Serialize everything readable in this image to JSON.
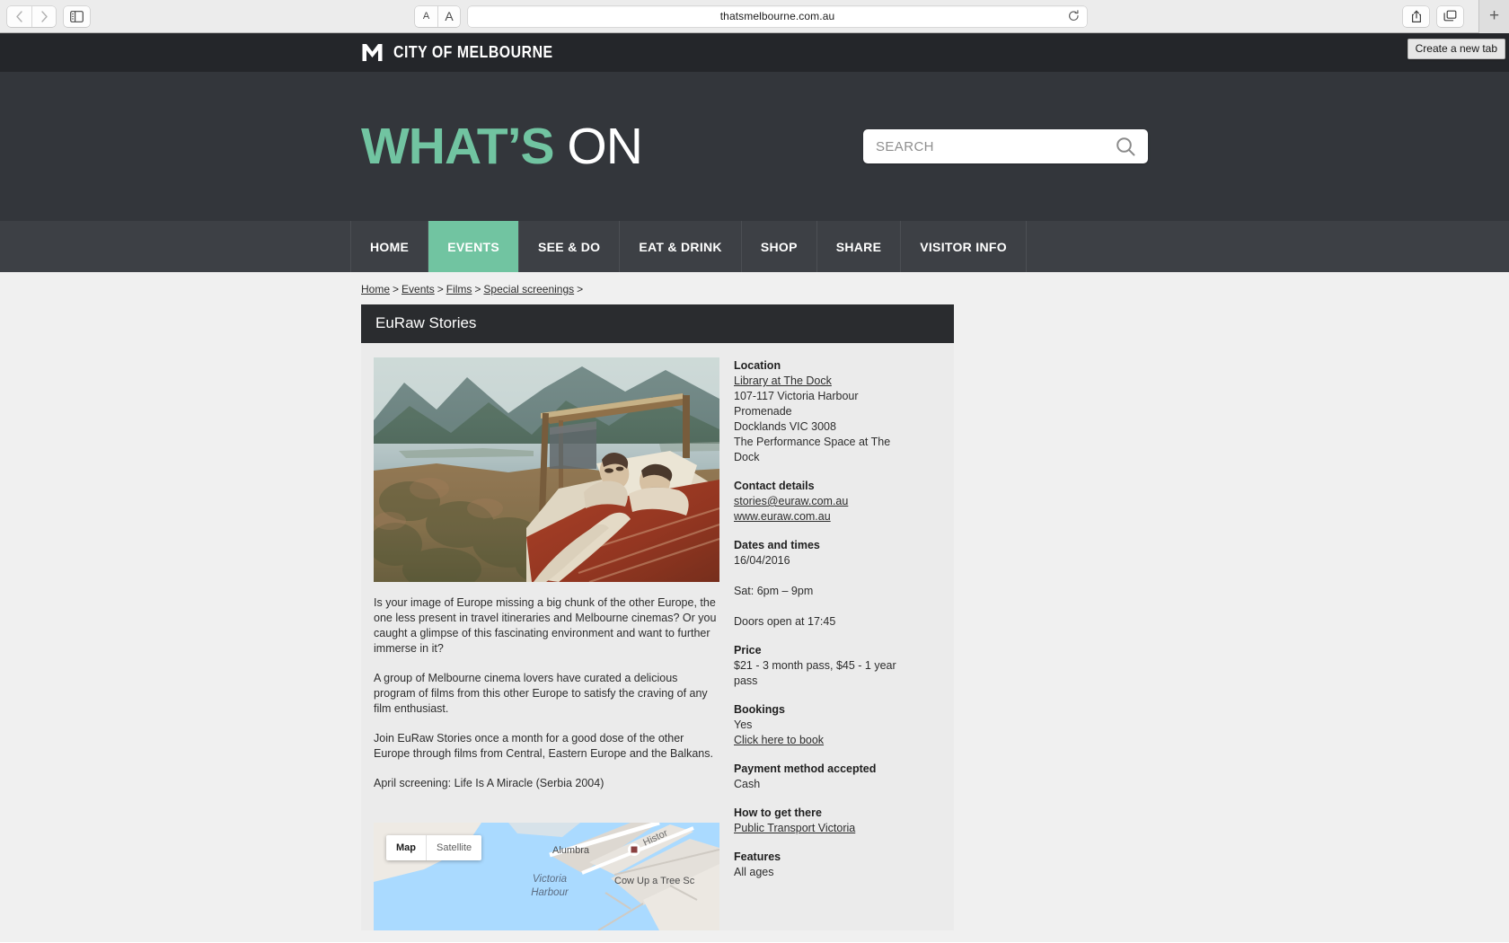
{
  "browser": {
    "url": "thatsmelbourne.com.au",
    "back_icon": "back-chevron-icon",
    "forward_icon": "forward-chevron-icon",
    "sidebar_icon": "sidebar-icon",
    "textsize_small": "A",
    "textsize_large": "A",
    "reload_icon": "reload-icon",
    "share_icon": "share-icon",
    "tabs_icon": "tab-overview-icon",
    "newtab_label": "+",
    "tooltip": "Create a new tab"
  },
  "site": {
    "brand": "CITY OF MELBOURNE",
    "title_accent": "WHAT’S",
    "title_rest": "ON",
    "accent_color": "#71c4a1",
    "header_bg": "#33363b",
    "brandbar_bg": "#24262a",
    "nav_bg": "#3d4045"
  },
  "search": {
    "placeholder": "SEARCH",
    "value": "",
    "icon": "search-icon"
  },
  "nav": {
    "items": [
      {
        "label": "HOME",
        "active": false
      },
      {
        "label": "EVENTS",
        "active": true
      },
      {
        "label": "SEE & DO",
        "active": false
      },
      {
        "label": "EAT & DRINK",
        "active": false
      },
      {
        "label": "SHOP",
        "active": false
      },
      {
        "label": "SHARE",
        "active": false
      },
      {
        "label": "VISITOR INFO",
        "active": false
      }
    ]
  },
  "breadcrumb": {
    "items": [
      "Home",
      "Events",
      "Films",
      "Special screenings"
    ],
    "separator": ">",
    "trailing": ">"
  },
  "event": {
    "title": "EuRaw Stories",
    "image_alt": "Film still: two people lying in a bed outdoors overlooking a lake and mountains",
    "paragraphs": [
      "Is your image of Europe missing a big chunk of the other Europe, the one less present in travel itineraries and Melbourne cinemas? Or you caught a glimpse of this fascinating environment and want to further immerse in it?",
      "A group of Melbourne cinema lovers have curated a delicious program of films from this other Europe to satisfy the craving of any film enthusiast.",
      "Join EuRaw Stories once a month for a good dose of the other Europe through films from Central, Eastern Europe and the Balkans.",
      "April screening: Life Is A Miracle (Serbia 2004)"
    ]
  },
  "sidebar": {
    "location": {
      "heading": "Location",
      "venue_link": "Library at The Dock",
      "lines": [
        "107-117 Victoria Harbour",
        "Promenade",
        "Docklands VIC 3008",
        "The Performance Space at The",
        "Dock"
      ]
    },
    "contact": {
      "heading": "Contact details",
      "email": "stories@euraw.com.au",
      "website": "www.euraw.com.au"
    },
    "dates": {
      "heading": "Dates and times",
      "date": "16/04/2016",
      "time": "Sat: 6pm – 9pm",
      "doors": "Doors open at 17:45"
    },
    "price": {
      "heading": "Price",
      "value": "$21 - 3 month pass, $45 - 1 year pass"
    },
    "bookings": {
      "heading": "Bookings",
      "value": "Yes",
      "link": "Click here to book"
    },
    "payment": {
      "heading": "Payment method accepted",
      "value": "Cash"
    },
    "transport": {
      "heading": "How to get there",
      "link": "Public Transport Victoria"
    },
    "features": {
      "heading": "Features",
      "value": "All ages"
    }
  },
  "map": {
    "tab_map": "Map",
    "tab_satellite": "Satellite",
    "labels": {
      "alumbra": "Alumbra",
      "history": "Histor",
      "harbour_line1": "Victoria",
      "harbour_line2": "Harbour",
      "cowuptree": "Cow Up a Tree Sc"
    }
  }
}
